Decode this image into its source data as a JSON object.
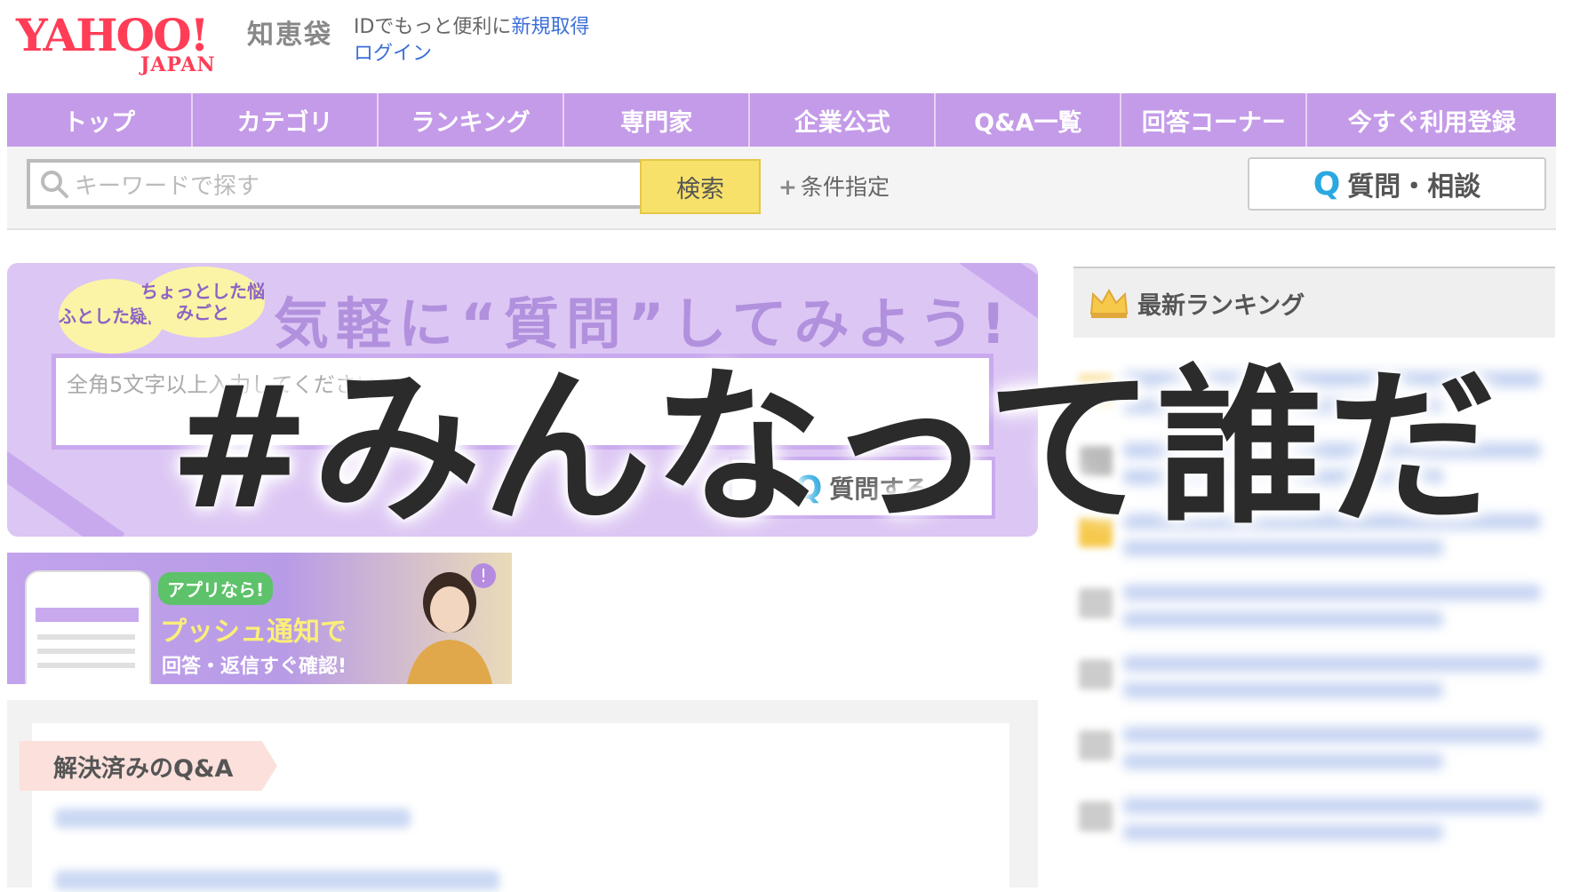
{
  "header": {
    "logo_yahoo": "YAHOO!",
    "logo_japan": "JAPAN",
    "logo_service": "知恵袋",
    "login_prefix": "IDでもっと便利に",
    "signup_link": "新規取得",
    "login_link": "ログイン"
  },
  "nav": {
    "items": [
      "トップ",
      "カテゴリ",
      "ランキング",
      "専門家",
      "企業公式",
      "Q&A一覧",
      "回答コーナー",
      "今すぐ利用登録"
    ]
  },
  "search": {
    "placeholder": "キーワードで探す",
    "button": "検索",
    "condition_link": "条件指定",
    "ask_button": "質問・相談"
  },
  "question_banner": {
    "bubble_a": "ふとした疑問",
    "bubble_b": "ちょっとした悩みごと",
    "title": "気軽に“質問”してみよう!",
    "textarea_placeholder": "全角5文字以上入力してください",
    "submit_button": "質問する"
  },
  "app_ad": {
    "pill": "アプリなら!",
    "headline": "プッシュ通知で",
    "sub": "回答・返信すぐ確認!"
  },
  "solved": {
    "tag": "解決済みのQ&A"
  },
  "ranking": {
    "title": "最新ランキング",
    "rank_colors": [
      "#f6c94b",
      "#bbbbbb",
      "#f6c94b",
      "#cccccc",
      "#cccccc",
      "#cccccc",
      "#cccccc"
    ]
  },
  "overlay": {
    "title": "#みんなって誰だ"
  },
  "colors": {
    "nav_bg": "#c49be8",
    "logo_red": "#ff3d57",
    "link_blue": "#3c6fd8",
    "search_button": "#f8e16a",
    "banner_bg": "#dcc6f4"
  }
}
